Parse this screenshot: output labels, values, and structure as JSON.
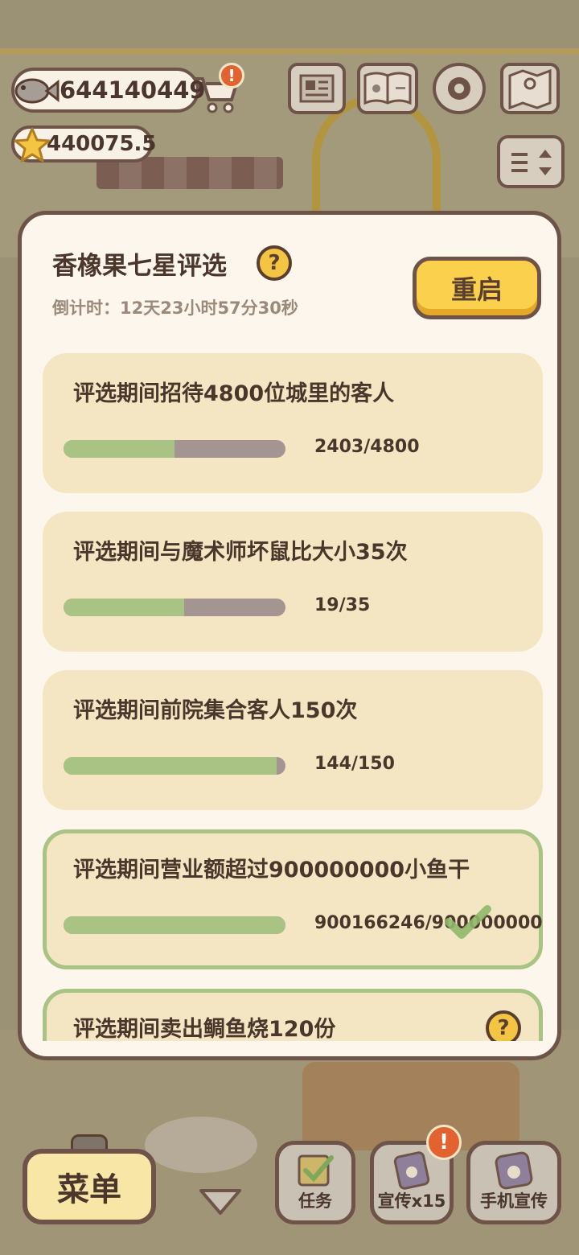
{
  "hud": {
    "fish_count": "644140449",
    "star_count": "440075.5",
    "cart_alert": "!",
    "icons": [
      "newspaper-icon",
      "paw-book-icon",
      "gear-icon",
      "map-icon",
      "sort-toggle-icon"
    ]
  },
  "panel": {
    "title": "香橡果七星评选",
    "help": "?",
    "countdown": "倒计时：12天23小时57分30秒",
    "restart_label": "重启"
  },
  "tasks": [
    {
      "text": "评选期间招待4800位城里的客人",
      "progress_text": "2403/4800",
      "current": 2403,
      "target": 4800,
      "done": false
    },
    {
      "text": "评选期间与魔术师坏鼠比大小35次",
      "progress_text": "19/35",
      "current": 19,
      "target": 35,
      "done": false
    },
    {
      "text": "评选期间前院集合客人150次",
      "progress_text": "144/150",
      "current": 144,
      "target": 150,
      "done": false
    },
    {
      "text": "评选期间营业额超过900000000小鱼干",
      "progress_text": "900166246/900000000",
      "current": 900166246,
      "target": 900000000,
      "done": true
    },
    {
      "text": "评选期间卖出鲷鱼烧120份",
      "help": "?",
      "done": true
    }
  ],
  "bottom_bar": {
    "menu_label": "菜单",
    "tasks_label": "任务",
    "promo_label": "宣传x15",
    "promo_alert": "!",
    "phone_promo_label": "手机宣传"
  },
  "colors": {
    "accent_yellow": "#fbd04d",
    "progress_green": "#a8c383",
    "progress_track": "#a49593",
    "outline_brown": "#6e5448",
    "card_bg": "#f4e6c3",
    "panel_bg": "#fdf6ed"
  }
}
